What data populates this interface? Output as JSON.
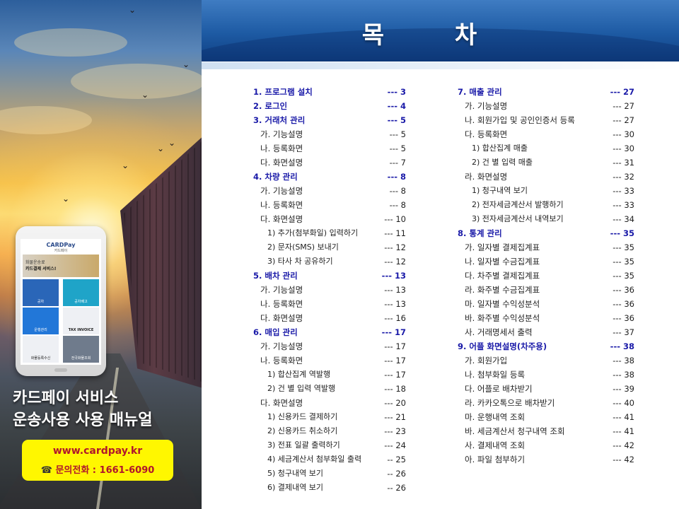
{
  "title": "목 차",
  "cover": {
    "title_line1": "카드페이 서비스",
    "title_line2": "운송사용 사용 매뉴얼",
    "website": "www.cardpay.kr",
    "phone_icon": "telephone-icon",
    "phone_text": "문의전화 : 1661-6090",
    "app": {
      "brand": "CARDPay",
      "brand_sub": "카드페이",
      "banner_line1": "화물운송료",
      "banner_line2": "카드결제 서비스!",
      "tiles": [
        "공차",
        "공차배고",
        "운행관리",
        "TAX INVOICE",
        "화물등록수신",
        "전국화물조회"
      ]
    }
  },
  "toc_left": [
    {
      "level": 1,
      "label": "1. 프로그램 설치",
      "page": "--- 3"
    },
    {
      "level": 1,
      "label": "2. 로그인",
      "page": "--- 4"
    },
    {
      "level": 1,
      "label": "3. 거래처 관리",
      "page": "--- 5"
    },
    {
      "level": 2,
      "label": "가. 기능설명",
      "page": "--- 5"
    },
    {
      "level": 2,
      "label": "나. 등록화면",
      "page": "--- 5"
    },
    {
      "level": 2,
      "label": "다. 화면설명",
      "page": "--- 7"
    },
    {
      "level": 1,
      "label": "4. 차량 관리",
      "page": "--- 8"
    },
    {
      "level": 2,
      "label": "가. 기능설명",
      "page": "--- 8"
    },
    {
      "level": 2,
      "label": "나. 등록화면",
      "page": "--- 8"
    },
    {
      "level": 2,
      "label": "다. 화면설명",
      "page": "--- 10"
    },
    {
      "level": 3,
      "label": "1) 추가(첨부화일) 입력하기",
      "page": "--- 11"
    },
    {
      "level": 3,
      "label": "2) 문자(SMS) 보내기",
      "page": "--- 12"
    },
    {
      "level": 3,
      "label": "3) 타사 차 공유하기",
      "page": "--- 12"
    },
    {
      "level": 1,
      "label": "5. 배차 관리",
      "page": "--- 13"
    },
    {
      "level": 2,
      "label": "가. 기능설명",
      "page": "--- 13"
    },
    {
      "level": 2,
      "label": "나. 등록화면",
      "page": "--- 13"
    },
    {
      "level": 2,
      "label": "다. 화면설명",
      "page": "--- 16"
    },
    {
      "level": 1,
      "label": "6. 매입 관리",
      "page": "--- 17"
    },
    {
      "level": 2,
      "label": "가. 기능설명",
      "page": "--- 17"
    },
    {
      "level": 2,
      "label": "나. 등록화면",
      "page": "--- 17"
    },
    {
      "level": 3,
      "label": "1) 합산집계 역발행",
      "page": "--- 17"
    },
    {
      "level": 3,
      "label": "2) 건 별 입력 역발행",
      "page": "--- 18"
    },
    {
      "level": 2,
      "label": "다. 화면설명",
      "page": "--- 20"
    },
    {
      "level": 3,
      "label": "1) 신용카드 결제하기",
      "page": "--- 21"
    },
    {
      "level": 3,
      "label": "2) 신용카드 취소하기",
      "page": "--- 23"
    },
    {
      "level": 3,
      "label": "3) 전표 일괄 출력하기",
      "page": "--- 24"
    },
    {
      "level": 3,
      "label": "4) 세금계산서 첨부화일 출력",
      "page": "-- 25"
    },
    {
      "level": 3,
      "label": "5) 청구내역 보기",
      "page": "-- 26"
    },
    {
      "level": 3,
      "label": "6) 결제내역 보기",
      "page": "-- 26"
    }
  ],
  "toc_right": [
    {
      "level": 1,
      "label": "7. 매출 관리",
      "page": "--- 27"
    },
    {
      "level": 2,
      "label": "가. 기능설명",
      "page": "--- 27"
    },
    {
      "level": 2,
      "label": "나. 회원가입 및 공인인증서 등록",
      "page": "--- 27"
    },
    {
      "level": 2,
      "label": "다. 등록화면",
      "page": "--- 30"
    },
    {
      "level": 3,
      "label": "1) 합산집계 매출",
      "page": "--- 30"
    },
    {
      "level": 3,
      "label": "2) 건 별 입력 매출",
      "page": "--- 31"
    },
    {
      "level": 2,
      "label": "라. 화면설명",
      "page": "--- 32"
    },
    {
      "level": 3,
      "label": "1) 청구내역 보기",
      "page": "--- 33"
    },
    {
      "level": 3,
      "label": "2) 전자세금계산서 발행하기",
      "page": "--- 33"
    },
    {
      "level": 3,
      "label": "3) 전자세금계산서 내역보기",
      "page": "--- 34"
    },
    {
      "level": 1,
      "label": "8. 통계 관리",
      "page": "--- 35"
    },
    {
      "level": 2,
      "label": "가. 일자별 결제집계표",
      "page": "--- 35"
    },
    {
      "level": 2,
      "label": "나. 일자별 수금집계표",
      "page": "--- 35"
    },
    {
      "level": 2,
      "label": "다. 차주별 결제집계표",
      "page": "--- 35"
    },
    {
      "level": 2,
      "label": "라. 화주별 수금집계표",
      "page": "--- 36"
    },
    {
      "level": 2,
      "label": "마. 일자별 수익성분석",
      "page": "--- 36"
    },
    {
      "level": 2,
      "label": "바. 화주별 수익성분석",
      "page": "--- 36"
    },
    {
      "level": 2,
      "label": "사. 거래명세서 출력",
      "page": "--- 37"
    },
    {
      "level": 1,
      "label": "9. 어플 화면설명(차주용)",
      "page": "--- 38"
    },
    {
      "level": 2,
      "label": "가. 회원가입",
      "page": "--- 38"
    },
    {
      "level": 2,
      "label": "나. 첨부화일 등록",
      "page": "--- 38"
    },
    {
      "level": 2,
      "label": "다. 어플로 배차받기",
      "page": "--- 39"
    },
    {
      "level": 2,
      "label": "라. 카카오톡으로 배차받기",
      "page": "--- 40"
    },
    {
      "level": 2,
      "label": "마. 운행내역 조회",
      "page": "--- 41"
    },
    {
      "level": 2,
      "label": "바. 세금계산서 청구내역 조회",
      "page": "--- 41"
    },
    {
      "level": 2,
      "label": "사. 결제내역 조회",
      "page": "--- 42"
    },
    {
      "level": 2,
      "label": "아. 파일 첨부하기",
      "page": "--- 42"
    }
  ]
}
